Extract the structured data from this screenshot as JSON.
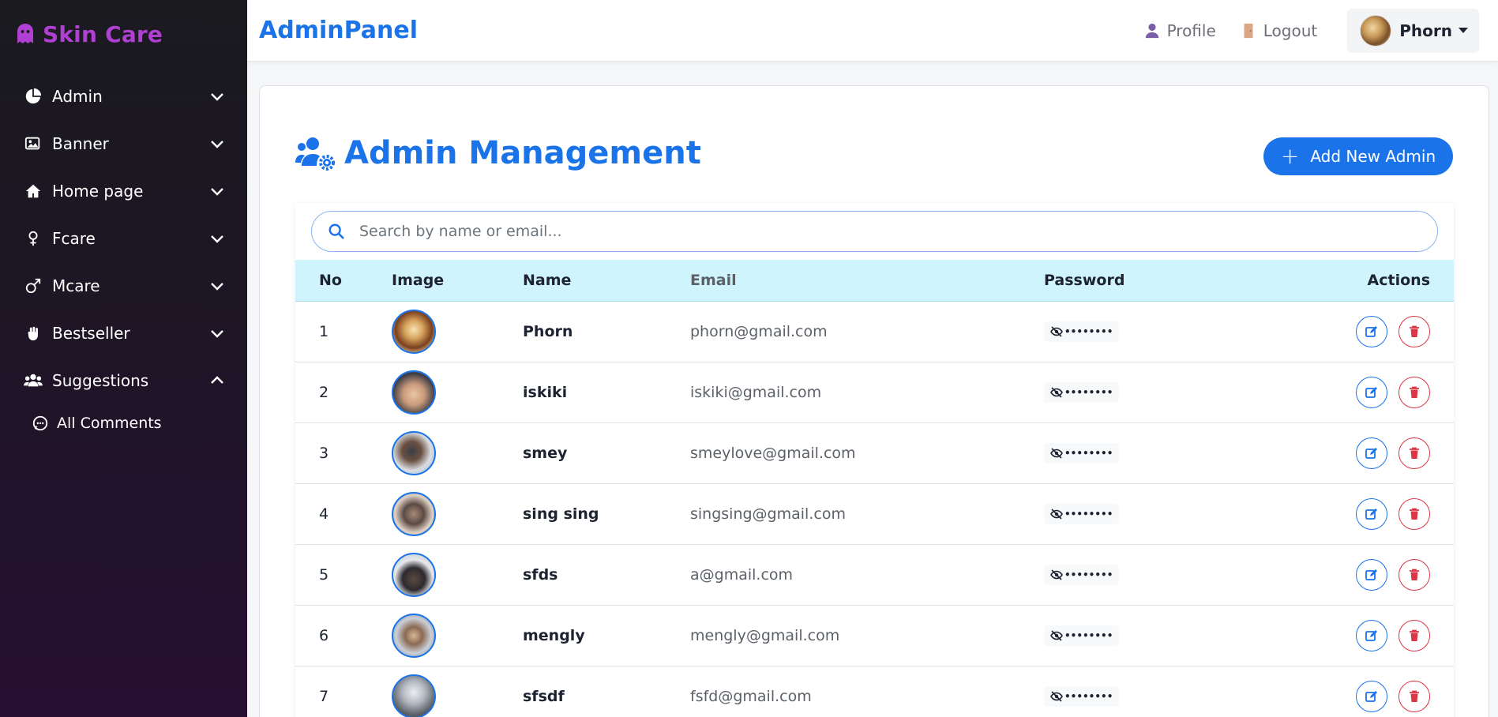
{
  "sidebar": {
    "brand": "Skin Care",
    "items": [
      {
        "label": "Admin",
        "icon": "chart-pie-icon"
      },
      {
        "label": "Banner",
        "icon": "image-icon"
      },
      {
        "label": "Home page",
        "icon": "house-icon"
      },
      {
        "label": "Fcare",
        "icon": "female-icon"
      },
      {
        "label": "Mcare",
        "icon": "male-icon"
      },
      {
        "label": "Bestseller",
        "icon": "hand-icon"
      },
      {
        "label": "Suggestions",
        "icon": "users-icon",
        "expanded": true
      }
    ],
    "sub_items": [
      {
        "label": "All Comments",
        "icon": "comment-icon"
      }
    ]
  },
  "topbar": {
    "title": "AdminPanel",
    "profile_label": "Profile",
    "logout_label": "Logout",
    "user_name": "Phorn"
  },
  "main": {
    "page_title": "Admin Management",
    "add_button_label": "Add New Admin",
    "search_placeholder": "Search by name or email...",
    "columns": [
      "No",
      "Image",
      "Name",
      "Email",
      "Password",
      "Actions"
    ],
    "rows": [
      {
        "no": "1",
        "name": "Phorn",
        "email": "phorn@gmail.com",
        "password": "••••••••"
      },
      {
        "no": "2",
        "name": "iskiki",
        "email": "iskiki@gmail.com",
        "password": "••••••••"
      },
      {
        "no": "3",
        "name": "smey",
        "email": "smeylove@gmail.com",
        "password": "••••••••"
      },
      {
        "no": "4",
        "name": "sing sing",
        "email": "singsing@gmail.com",
        "password": "••••••••"
      },
      {
        "no": "5",
        "name": "sfds",
        "email": "a@gmail.com",
        "password": "••••••••"
      },
      {
        "no": "6",
        "name": "mengly",
        "email": "mengly@gmail.com",
        "password": "••••••••"
      },
      {
        "no": "7",
        "name": "sfsdf",
        "email": "fsfd@gmail.com",
        "password": "••••••••"
      }
    ]
  },
  "colors": {
    "accent": "#1a73e8",
    "brand": "#b03fd4",
    "danger": "#dc3545",
    "header_row": "#cff4fc"
  }
}
